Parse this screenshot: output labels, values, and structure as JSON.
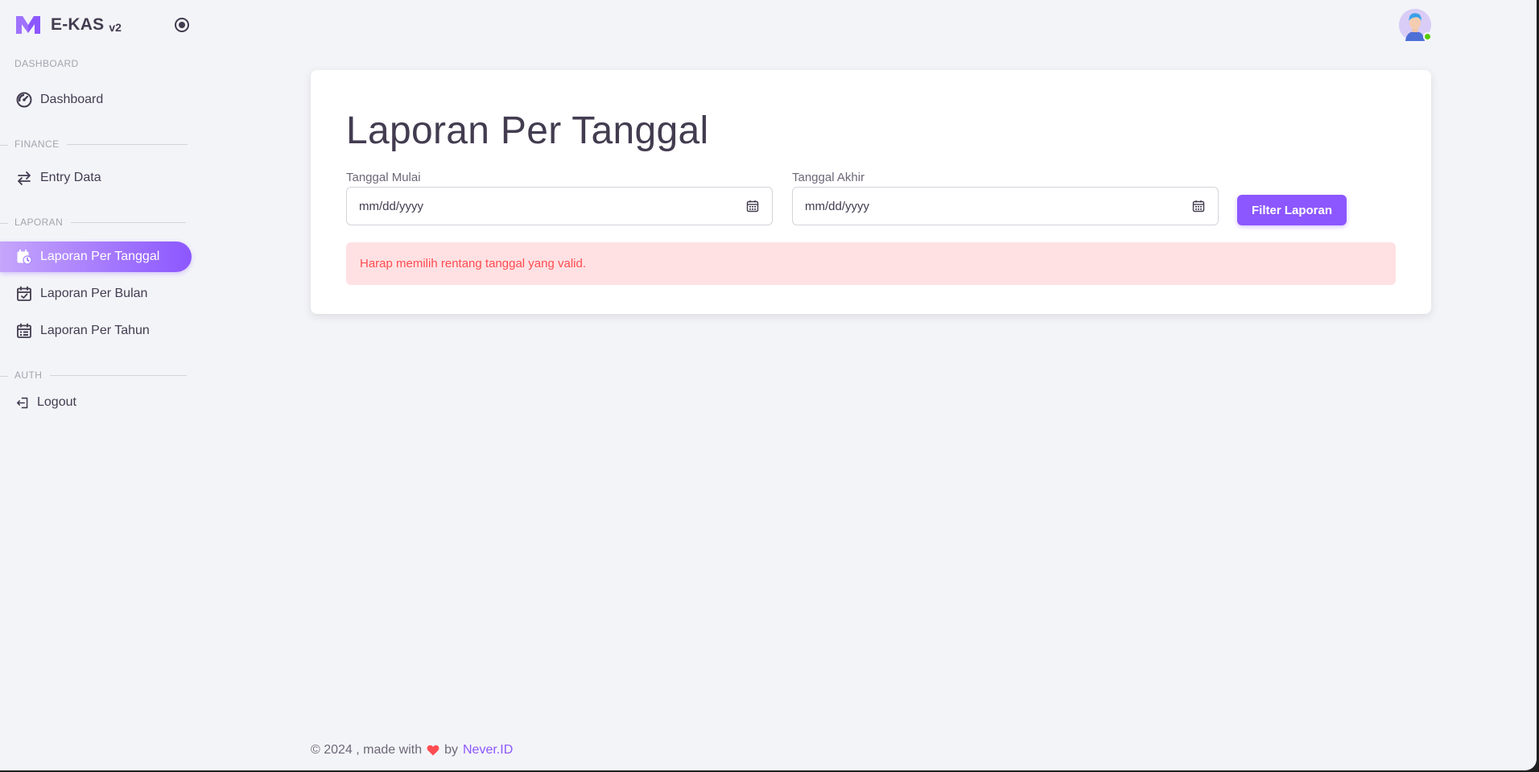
{
  "brand": {
    "name": "E-KAS",
    "version": "v2"
  },
  "sidebar": {
    "sections": [
      {
        "title": "DASHBOARD"
      },
      {
        "title": "FINANCE"
      },
      {
        "title": "LAPORAN"
      },
      {
        "title": "AUTH"
      }
    ],
    "items": [
      {
        "label": "Dashboard",
        "icon": "gauge-icon"
      },
      {
        "label": "Entry Data",
        "icon": "arrows-left-right-icon"
      },
      {
        "label": "Laporan Per Tanggal",
        "icon": "calendar-clock-icon",
        "active": true
      },
      {
        "label": "Laporan Per Bulan",
        "icon": "calendar-check-icon"
      },
      {
        "label": "Laporan Per Tahun",
        "icon": "calendar-list-icon"
      },
      {
        "label": "Logout",
        "icon": "logout-icon"
      }
    ]
  },
  "main": {
    "title": "Laporan Per Tanggal",
    "start_date": {
      "label": "Tanggal Mulai",
      "value": "mm/dd/yyyy"
    },
    "end_date": {
      "label": "Tanggal Akhir",
      "value": "mm/dd/yyyy"
    },
    "filter_button": "Filter Laporan",
    "alert": "Harap memilih rentang tanggal yang valid."
  },
  "footer": {
    "prefix": "© 2024 , made with",
    "by": "by",
    "link": "Never.ID"
  },
  "colors": {
    "primary": "#8c57ff",
    "danger": "#ff4c51",
    "danger_bg": "#ffe1e3",
    "background": "#f3f4f8",
    "online": "#56ca00"
  }
}
